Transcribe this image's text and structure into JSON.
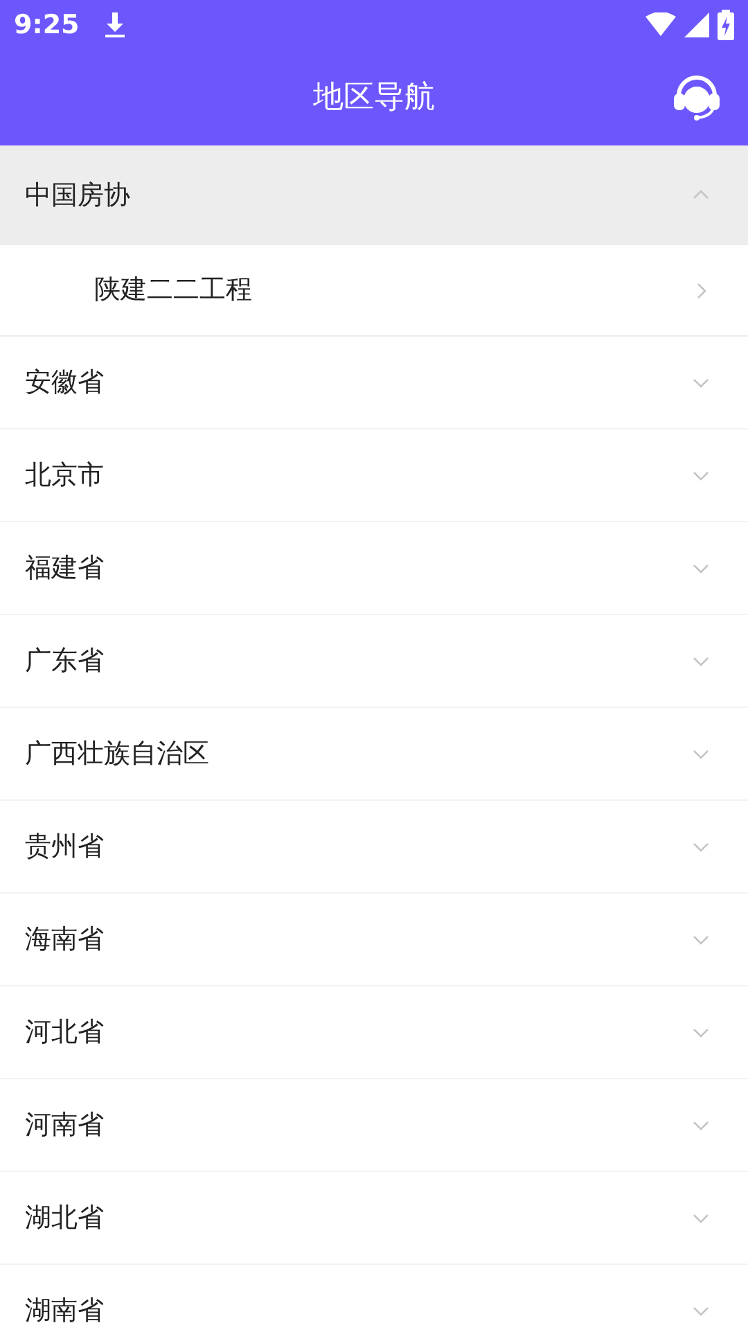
{
  "status_bar": {
    "time": "9:25"
  },
  "header": {
    "title": "地区导航"
  },
  "regions": [
    {
      "name": "中国房协",
      "expanded": true,
      "children": [
        {
          "name": "陕建二二工程"
        }
      ]
    },
    {
      "name": "安徽省",
      "expanded": false
    },
    {
      "name": "北京市",
      "expanded": false
    },
    {
      "name": "福建省",
      "expanded": false
    },
    {
      "name": "广东省",
      "expanded": false
    },
    {
      "name": "广西壮族自治区",
      "expanded": false
    },
    {
      "name": "贵州省",
      "expanded": false
    },
    {
      "name": "海南省",
      "expanded": false
    },
    {
      "name": "河北省",
      "expanded": false
    },
    {
      "name": "河南省",
      "expanded": false
    },
    {
      "name": "湖北省",
      "expanded": false
    },
    {
      "name": "湖南省",
      "expanded": false
    }
  ]
}
